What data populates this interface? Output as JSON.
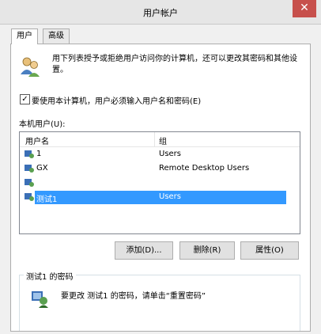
{
  "window": {
    "title": "用户帐户",
    "close_glyph": "✕"
  },
  "tabs": [
    {
      "label": "用户",
      "active": true
    },
    {
      "label": "高级",
      "active": false
    }
  ],
  "description": "用下列表授予或拒绝用户访问你的计算机，还可以更改其密码和其他设置。",
  "require_password": {
    "label": "要使用本计算机，用户必须输入用户名和密码(E)",
    "checked": true,
    "mark": "✓"
  },
  "local_users_label": "本机用户(U):",
  "columns": {
    "name": "用户名",
    "group": "组"
  },
  "users": [
    {
      "name": "1",
      "group": "Users",
      "selected": false
    },
    {
      "name": "GX",
      "group": "Remote Desktop Users",
      "selected": false
    },
    {
      "name": "",
      "group": "",
      "selected": false
    },
    {
      "name": "测试1",
      "group": "Users",
      "selected": true
    }
  ],
  "buttons": {
    "add": "添加(D)...",
    "remove": "删除(R)",
    "properties": "属性(O)"
  },
  "password_group": {
    "title": "测试1 的密码",
    "text": "要更改 测试1 的密码，请单击“重置密码”"
  },
  "colors": {
    "selection": "#3399ff",
    "close": "#c7504c"
  }
}
